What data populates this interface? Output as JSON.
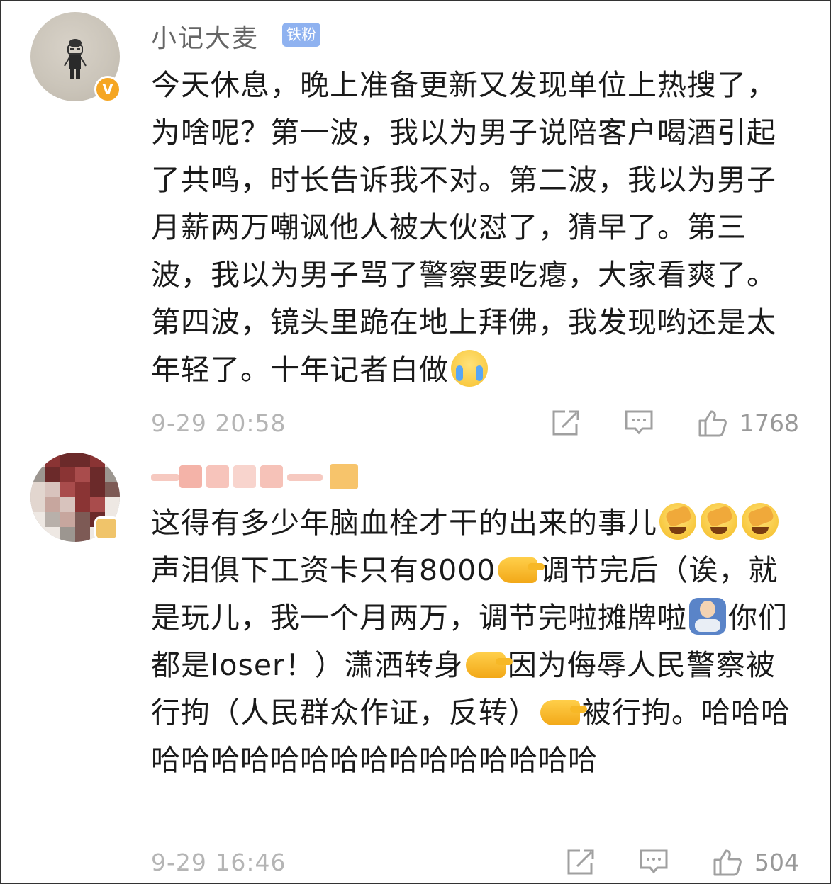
{
  "comments": [
    {
      "username": "小记大麦",
      "badge": "铁粉",
      "verified_mark": "V",
      "avatar": "sketch-figure-avatar",
      "text_1": "今天休息，晚上准备更新又发现单位上热搜了，为啥呢？第一波，我以为男子说陪客户喝酒引起了共鸣，时长告诉我不对。第二波，我以为男子月薪两万嘲讽他人被大伙怼了，猜早了。第三波，我以为男子骂了警察要吃瘪，大家看爽了。第四波，镜头里跪在地上拜佛，我发现哟还是太年轻了。十年记者白做",
      "timestamp": "9-29 20:58",
      "likes": "1768",
      "colors": {
        "badge_bg": "#8fb2f0",
        "verified": "#f5a623"
      }
    },
    {
      "username": "",
      "avatar": "pixelated-avatar",
      "seg_1": "这得有多少年脑血栓才干的出来的事儿",
      "seg_2": "声泪俱下工资卡只有8000",
      "seg_3": "调节完后（诶，就是玩儿，我一个月两万，调节完啦摊牌啦",
      "seg_4": "你们都是loser！）潇洒转身",
      "seg_5": "因为侮辱人民警察被行拘（人民群众作证，反转）",
      "seg_6": "被行拘。哈哈哈哈哈哈哈哈哈哈哈哈哈哈哈哈哈哈",
      "timestamp": "9-29 16:46",
      "likes": "504"
    }
  ],
  "icons": [
    "share-icon",
    "comment-icon",
    "like-icon"
  ]
}
